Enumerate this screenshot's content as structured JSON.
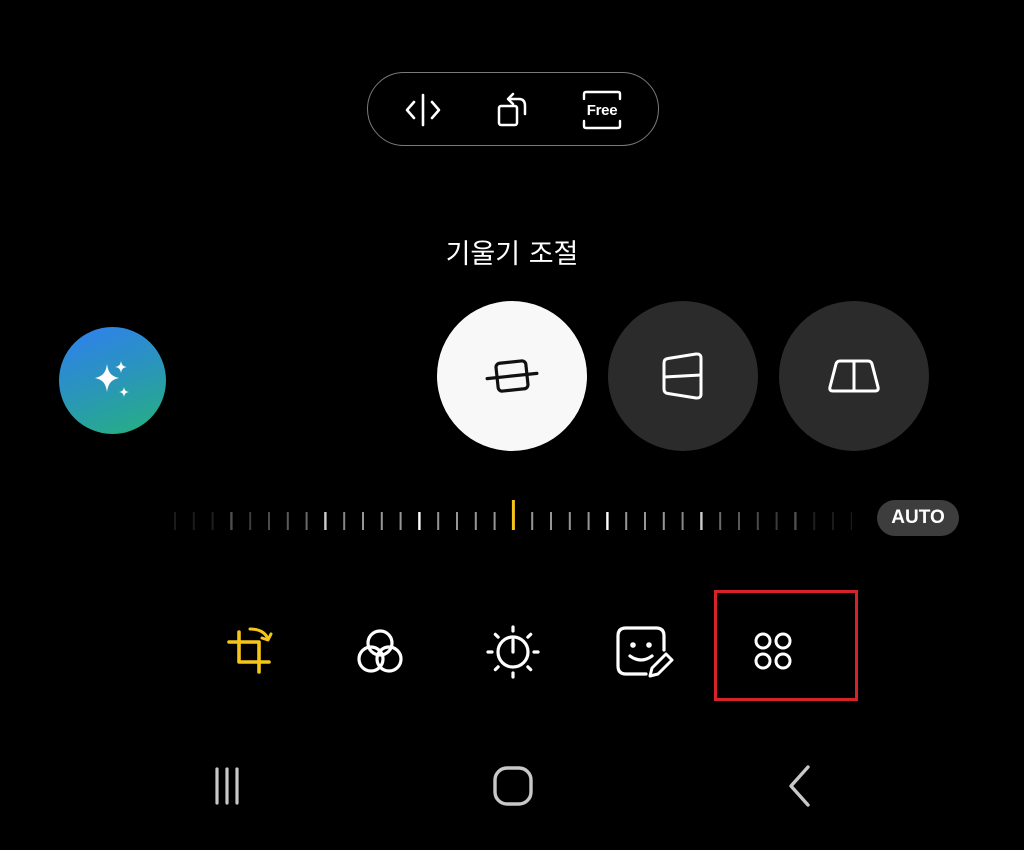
{
  "top_toolbar": {
    "buttons": [
      {
        "icon": "flip-horizontal-icon"
      },
      {
        "icon": "rotate-icon"
      },
      {
        "icon": "free-ratio-icon",
        "label": "Free"
      }
    ]
  },
  "adjust": {
    "title": "기울기 조절",
    "modes": [
      {
        "icon": "straighten-icon",
        "selected": true
      },
      {
        "icon": "horizontal-perspective-icon",
        "selected": false
      },
      {
        "icon": "vertical-perspective-icon",
        "selected": false
      }
    ],
    "auto_label": "AUTO"
  },
  "ai_button": {
    "icon": "sparkle-icon"
  },
  "bottom_tools": [
    {
      "icon": "crop-rotate-icon",
      "active": true
    },
    {
      "icon": "filters-icon",
      "active": false
    },
    {
      "icon": "brightness-icon",
      "active": false
    },
    {
      "icon": "sticker-icon",
      "active": false
    },
    {
      "icon": "more-tools-icon",
      "active": false,
      "highlighted": true
    }
  ],
  "nav_bar": [
    {
      "icon": "recent-apps-icon"
    },
    {
      "icon": "home-icon"
    },
    {
      "icon": "back-icon"
    }
  ],
  "colors": {
    "background": "#000000",
    "accent": "#f5c518",
    "highlight_box": "#d6232a"
  }
}
